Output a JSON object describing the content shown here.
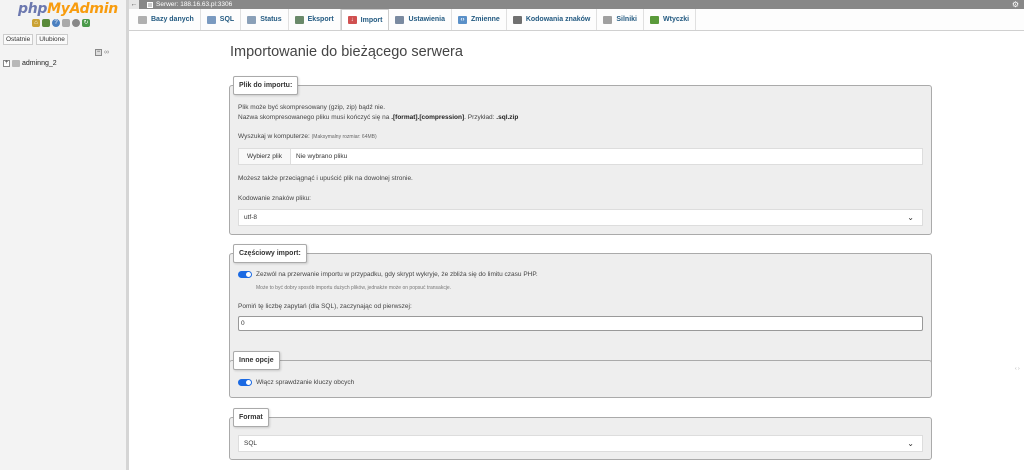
{
  "nav": {
    "logo_php": "php",
    "logo_myadmin": "MyAdmin",
    "tabs": [
      "Ostatnie",
      "Ulubione"
    ],
    "collapse_link": "∞",
    "db_name": "adminng_2"
  },
  "serverbar": {
    "server_label": "Serwer: 188.16.63.pl:3306"
  },
  "menu": {
    "tabs": [
      {
        "label": "Bazy danych",
        "icon": "database-icon"
      },
      {
        "label": "SQL",
        "icon": "sql-icon"
      },
      {
        "label": "Status",
        "icon": "status-icon"
      },
      {
        "label": "Eksport",
        "icon": "export-icon"
      },
      {
        "label": "Import",
        "icon": "import-icon",
        "active": true
      },
      {
        "label": "Ustawienia",
        "icon": "settings-icon"
      },
      {
        "label": "Zmienne",
        "icon": "variables-icon"
      },
      {
        "label": "Kodowania znaków",
        "icon": "charsets-icon"
      },
      {
        "label": "Silniki",
        "icon": "engines-icon"
      },
      {
        "label": "Wtyczki",
        "icon": "plugins-icon"
      }
    ]
  },
  "main": {
    "title": "Importowanie do bieżącego serwera",
    "file_section": {
      "legend": "Plik do importu:",
      "line1": "Plik może być skompresowany (gzip, zip) bądź nie.",
      "line2_a": "Nazwa skompresowanego pliku musi kończyć się na ",
      "line2_b": ".[format].[compression]",
      "line2_c": ". Przykład: ",
      "line2_d": ".sql.zip",
      "browse_label": "Wyszukaj w komputerze: ",
      "max_size": "(Maksymalny rozmiar: 64MB)",
      "choose_button": "Wybierz plik",
      "no_file": "Nie wybrano pliku",
      "drag_drop": "Możesz także przeciągnąć i upuścić plik na dowolnej stronie.",
      "charset_label": "Kodowanie znaków pliku:",
      "charset_value": "utf-8"
    },
    "partial_section": {
      "legend": "Częściowy import:",
      "interrupt_label": "Zezwól na przerwanie importu w przypadku, gdy skrypt wykryje, że zbliża się do limitu czasu PHP.",
      "interrupt_hint": "Może to być dobry sposób importu dużych plików, jednakże może on popsuć transakcje.",
      "skip_label": "Pomiń tę liczbę zapytań (dla SQL), zaczynając od pierwszej:",
      "skip_value": "0"
    },
    "other_section": {
      "legend": "Inne opcje",
      "fk_label": "Włącz sprawdzanie kluczy obcych"
    },
    "format_section": {
      "legend": "Format",
      "format_value": "SQL"
    }
  },
  "colors": {
    "tab_text": "#235a81",
    "toggle_on": "#1b6ae3",
    "fieldset_bg": "#eeeeee"
  }
}
